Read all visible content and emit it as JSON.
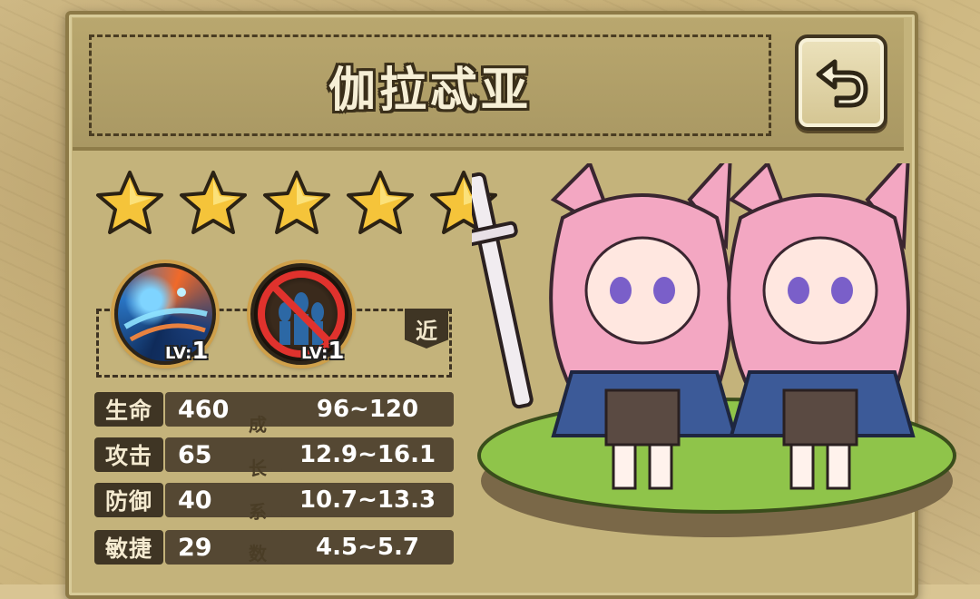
{
  "hero": {
    "name": "伽拉忒亚",
    "stars": 5,
    "range": "近"
  },
  "skills": [
    {
      "name": "skill-1",
      "level_prefix": "LV:",
      "level": "1"
    },
    {
      "name": "skill-2",
      "level_prefix": "LV:",
      "level": "1"
    }
  ],
  "stats": [
    {
      "label": "生命",
      "value": "460",
      "growth": "96~120"
    },
    {
      "label": "攻击",
      "value": "65",
      "growth": "12.9~16.1"
    },
    {
      "label": "防御",
      "value": "40",
      "growth": "10.7~13.3"
    },
    {
      "label": "敏捷",
      "value": "29",
      "growth": "4.5~5.7"
    }
  ],
  "growth_label": [
    "成",
    "长",
    "系",
    "数"
  ],
  "colors": {
    "panel": "#c4b37b",
    "dark_plate": "#3f3524",
    "value_plate": "#554833",
    "star": "#f5c43a",
    "hair": "#f3a7c2"
  },
  "icons": {
    "back": "return-arrow-icon",
    "star": "star-icon"
  }
}
